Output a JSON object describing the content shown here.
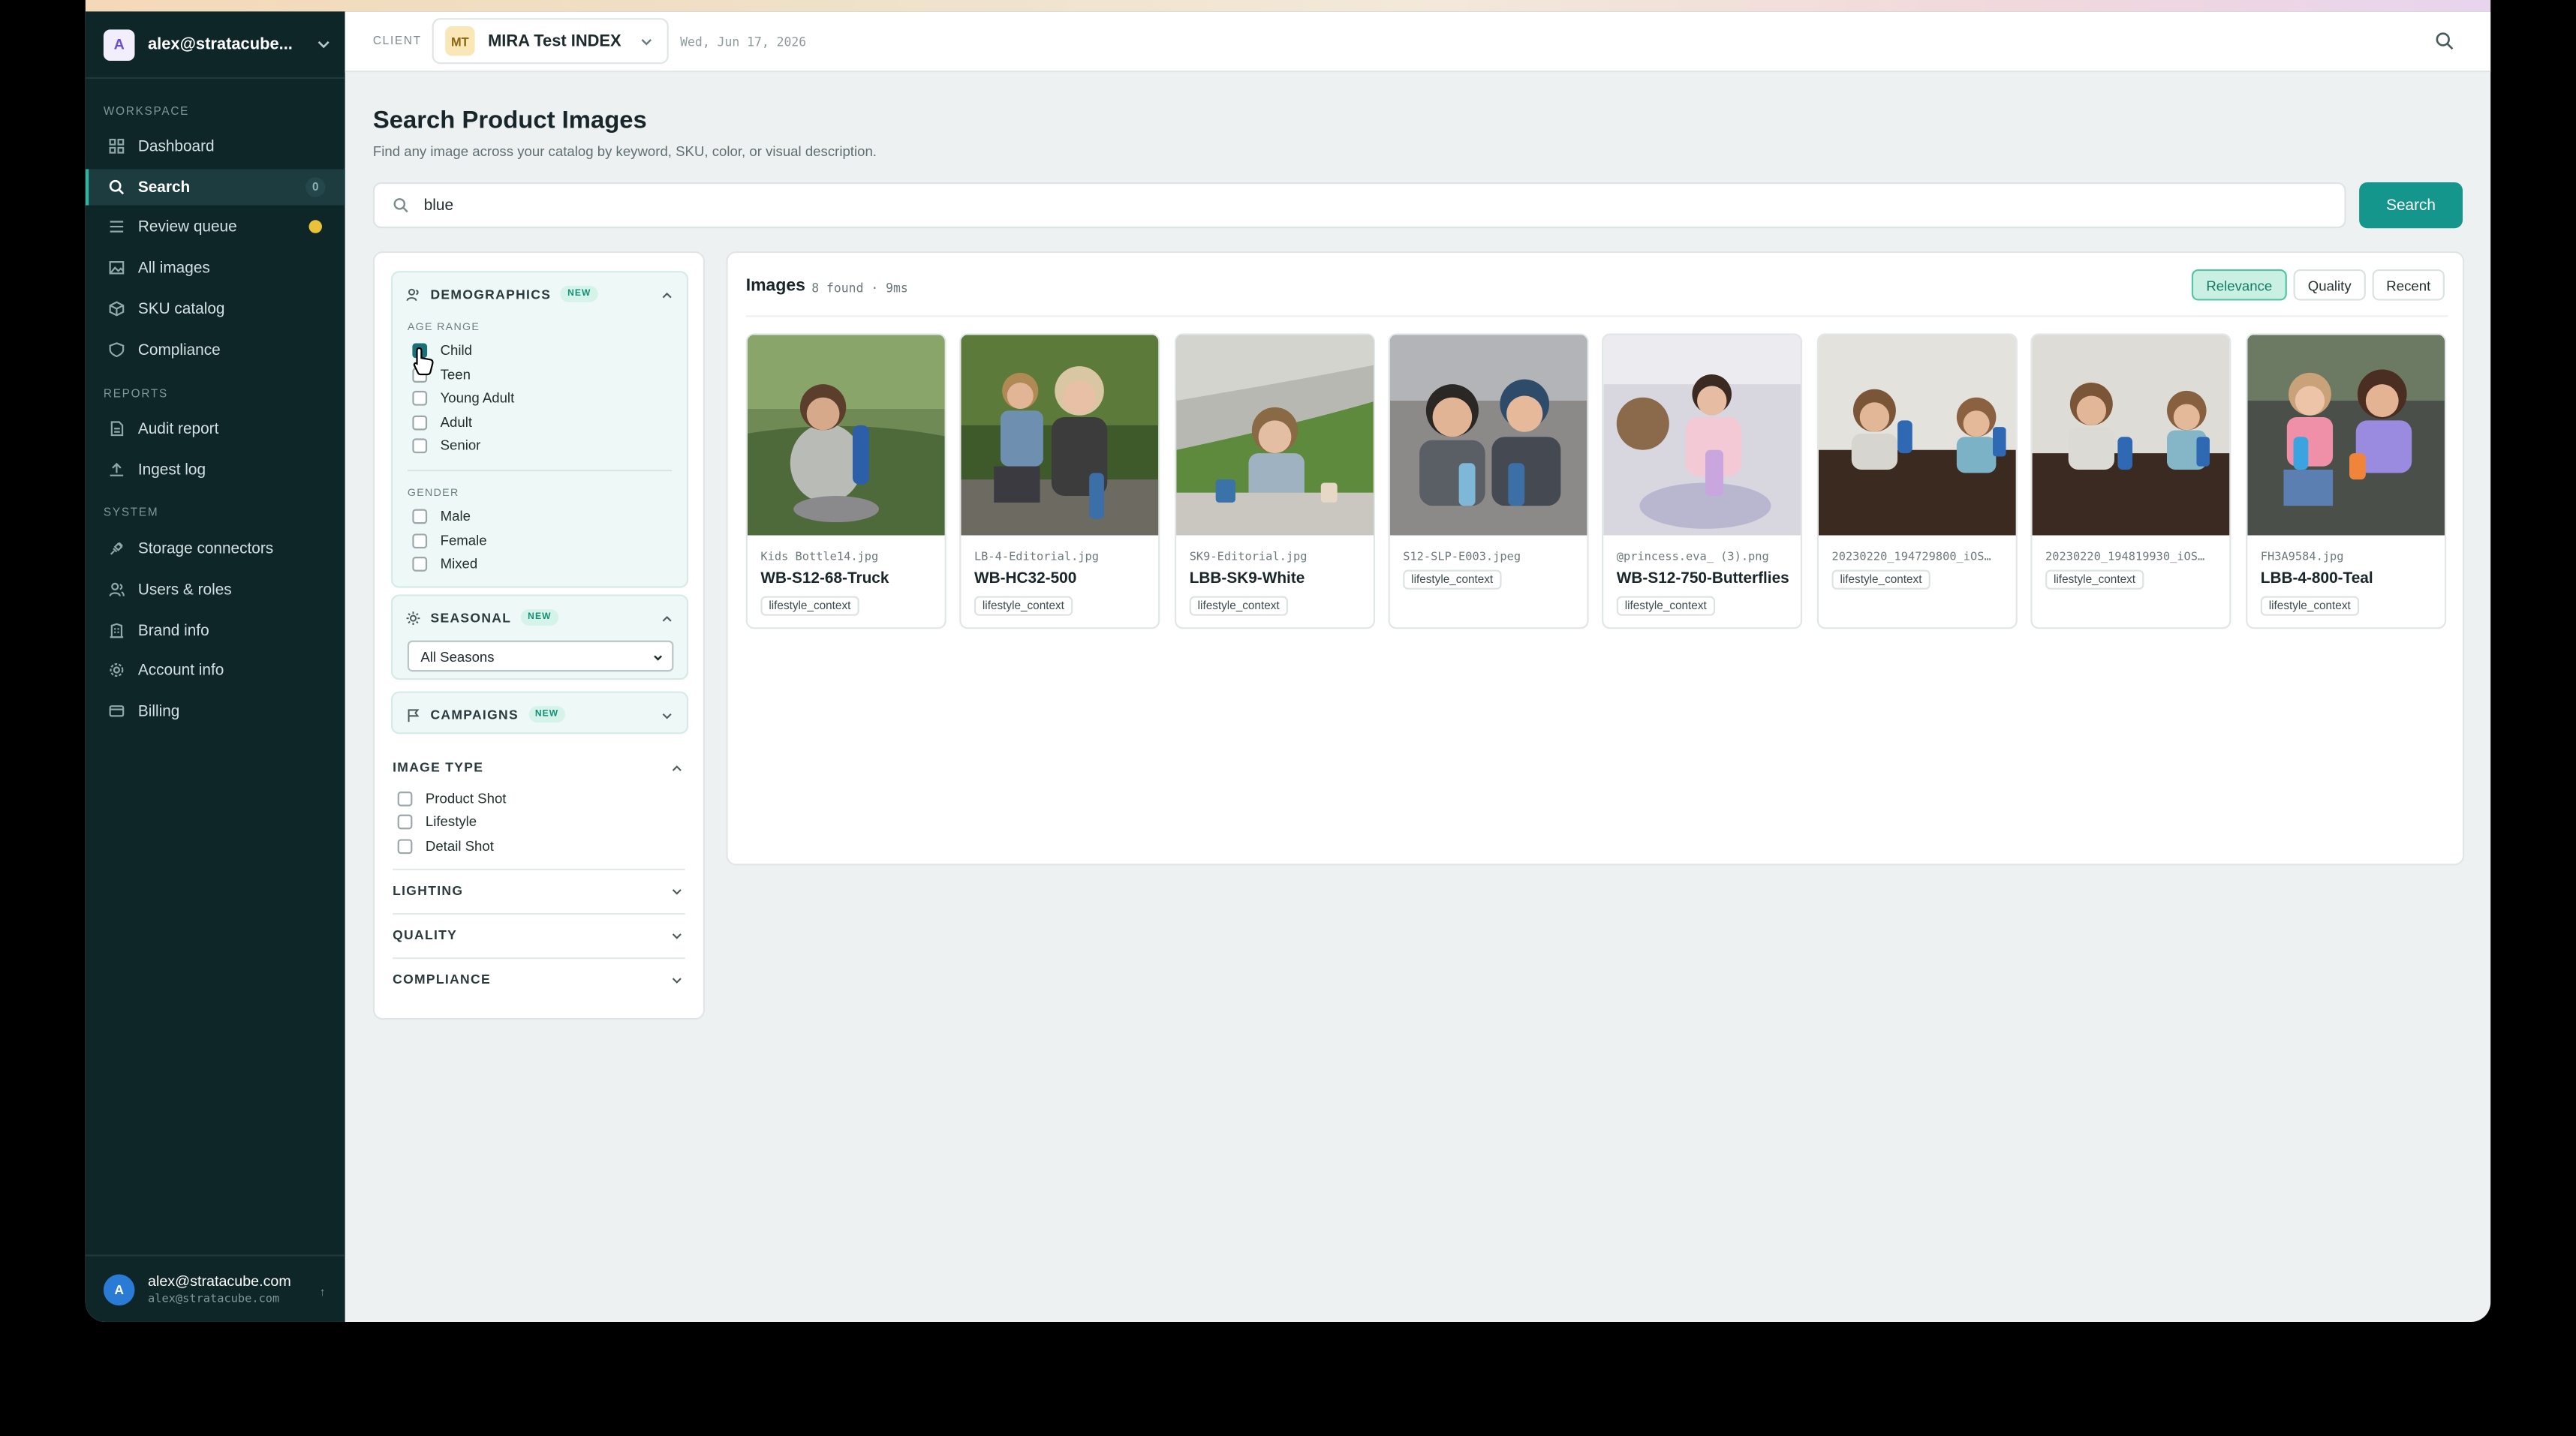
{
  "sidebar": {
    "account_initial": "A",
    "account_name": "alex@stratacube...",
    "sections": {
      "workspace": "WORKSPACE",
      "reports": "REPORTS",
      "system": "SYSTEM"
    },
    "items": [
      {
        "label": "Dashboard",
        "icon": "grid-icon"
      },
      {
        "label": "Search",
        "icon": "search-icon",
        "count": "0",
        "active": true
      },
      {
        "label": "Review queue",
        "icon": "list-icon",
        "indicator": "yellow-dot"
      },
      {
        "label": "All images",
        "icon": "image-icon"
      },
      {
        "label": "SKU catalog",
        "icon": "box-icon"
      },
      {
        "label": "Compliance",
        "icon": "shield-icon"
      },
      {
        "label": "Audit report",
        "icon": "document-icon"
      },
      {
        "label": "Ingest log",
        "icon": "upload-icon"
      },
      {
        "label": "Storage connectors",
        "icon": "plug-icon"
      },
      {
        "label": "Users & roles",
        "icon": "users-icon"
      },
      {
        "label": "Brand info",
        "icon": "building-icon"
      },
      {
        "label": "Account info",
        "icon": "gear-icon"
      },
      {
        "label": "Billing",
        "icon": "card-icon"
      }
    ],
    "user": {
      "initial": "A",
      "name": "alex@stratacube.com",
      "email": "alex@stratacube.com"
    }
  },
  "header": {
    "client_label": "CLIENT",
    "client_initials": "MT",
    "client_name": "MIRA Test INDEX",
    "date": "Wed, Jun 17, 2026"
  },
  "page": {
    "title": "Search Product Images",
    "subtitle": "Find any image across your catalog by keyword, SKU, color, or visual description.",
    "search_value": "blue",
    "search_button": "Search"
  },
  "filters": {
    "demographics": {
      "title": "DEMOGRAPHICS",
      "badge": "NEW",
      "age_label": "AGE RANGE",
      "age_options": [
        {
          "label": "Child",
          "checked": true
        },
        {
          "label": "Teen",
          "checked": false
        },
        {
          "label": "Young Adult",
          "checked": false
        },
        {
          "label": "Adult",
          "checked": false
        },
        {
          "label": "Senior",
          "checked": false
        }
      ],
      "gender_label": "GENDER",
      "gender_options": [
        {
          "label": "Male",
          "checked": false
        },
        {
          "label": "Female",
          "checked": false
        },
        {
          "label": "Mixed",
          "checked": false
        }
      ]
    },
    "seasonal": {
      "title": "SEASONAL",
      "badge": "NEW",
      "selected": "All Seasons"
    },
    "campaigns": {
      "title": "CAMPAIGNS",
      "badge": "NEW"
    },
    "image_type": {
      "title": "IMAGE TYPE",
      "options": [
        {
          "label": "Product Shot",
          "checked": false
        },
        {
          "label": "Lifestyle",
          "checked": false
        },
        {
          "label": "Detail Shot",
          "checked": false
        }
      ]
    },
    "lighting": "LIGHTING",
    "quality": "QUALITY",
    "compliance": "COMPLIANCE"
  },
  "results": {
    "title": "Images",
    "meta": "8 found · 9ms",
    "sort": [
      {
        "label": "Relevance",
        "active": true
      },
      {
        "label": "Quality",
        "active": false
      },
      {
        "label": "Recent",
        "active": false
      }
    ],
    "cards": [
      {
        "filename": "Kids Bottle14.jpg",
        "sku": "WB-S12-68-Truck",
        "tag": "lifestyle_context"
      },
      {
        "filename": "LB-4-Editorial.jpg",
        "sku": "WB-HC32-500",
        "tag": "lifestyle_context"
      },
      {
        "filename": "SK9-Editorial.jpg",
        "sku": "LBB-SK9-White",
        "tag": "lifestyle_context"
      },
      {
        "filename": "S12-SLP-E003.jpeg",
        "sku": "",
        "tag": "lifestyle_context"
      },
      {
        "filename": "@princess.eva_ (3).png",
        "sku": "WB-S12-750-Butterflies",
        "tag": "lifestyle_context"
      },
      {
        "filename": "20230220_194729800_iOS…",
        "sku": "",
        "tag": "lifestyle_context"
      },
      {
        "filename": "20230220_194819930_iOS…",
        "sku": "",
        "tag": "lifestyle_context"
      },
      {
        "filename": "FH3A9584.jpg",
        "sku": "LBB-4-800-Teal",
        "tag": "lifestyle_context"
      }
    ]
  }
}
